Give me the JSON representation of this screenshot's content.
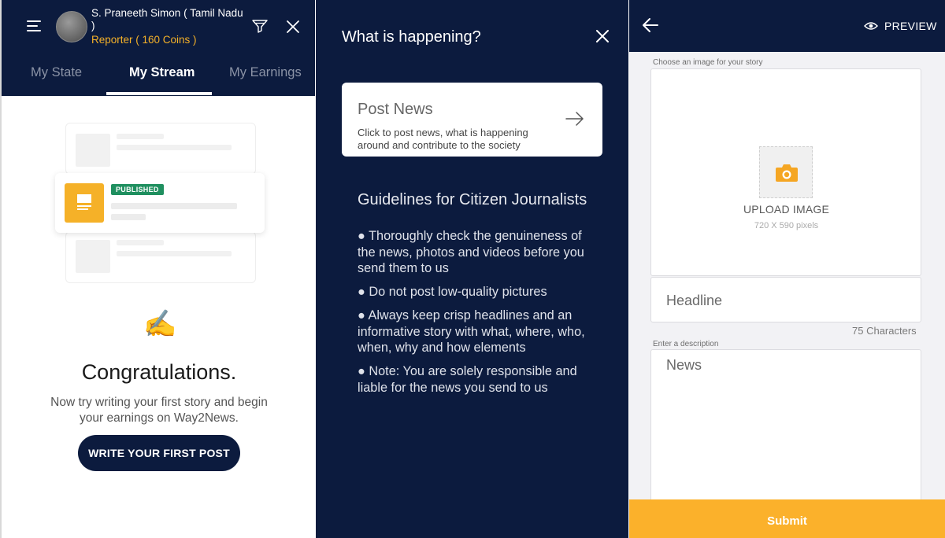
{
  "colors": {
    "navy": "#0c1b3e",
    "accent": "#f5b128",
    "published_green": "#1f8f5f",
    "submit": "#fbb12b"
  },
  "stream_screen": {
    "menu_icon": "hamburger-icon",
    "user_name": "S. Praneeth Simon ( Tamil Nadu )",
    "user_role": "Reporter ( 160 Coins )",
    "filter_icon": "filter-icon",
    "close_icon": "close-icon",
    "tabs": [
      {
        "label": "My State",
        "active": false
      },
      {
        "label": "My Stream",
        "active": true
      },
      {
        "label": "My Earnings",
        "active": false
      }
    ],
    "published_badge": "PUBLISHED",
    "emoji": "✍️",
    "congrats_title": "Congratulations.",
    "congrats_text": "Now try writing your first story and begin your earnings on Way2News.",
    "cta_label": "WRITE YOUR FIRST POST"
  },
  "happening_screen": {
    "title": "What is happening?",
    "post_card": {
      "title": "Post News",
      "description": "Click to post news, what is happening around and contribute to the society"
    },
    "guidelines_title": "Guidelines for Citizen Journalists",
    "guidelines": [
      "● Thoroughly check the genuineness of the news, photos and videos before you send them to us",
      "● Do not post low-quality pictures",
      "● Always keep crisp headlines and an informative story with what, where, who, when, why and how elements",
      "● Note: You are solely responsible and liable for the news you send to us"
    ]
  },
  "compose_screen": {
    "preview_label": "PREVIEW",
    "image_label": "Choose an image for your story",
    "upload_label": "UPLOAD IMAGE",
    "upload_size": "720 X 590 pixels",
    "headline_placeholder": "Headline",
    "headline_counter": "75 Characters",
    "description_label": "Enter a description",
    "description_placeholder": "News",
    "submit_label": "Submit"
  }
}
